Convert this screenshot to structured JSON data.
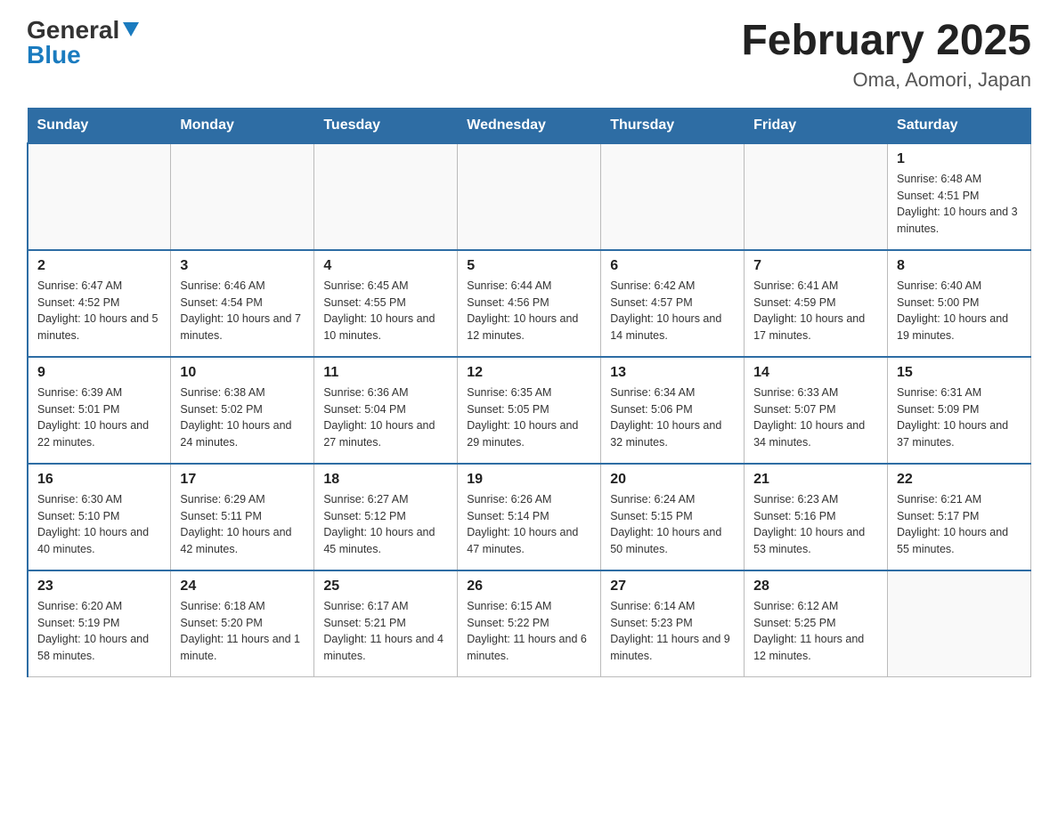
{
  "header": {
    "logo_general": "General",
    "logo_blue": "Blue",
    "month_title": "February 2025",
    "location": "Oma, Aomori, Japan"
  },
  "days_of_week": [
    "Sunday",
    "Monday",
    "Tuesday",
    "Wednesday",
    "Thursday",
    "Friday",
    "Saturday"
  ],
  "weeks": [
    [
      {
        "day": "",
        "sunrise": "",
        "sunset": "",
        "daylight": "",
        "empty": true
      },
      {
        "day": "",
        "sunrise": "",
        "sunset": "",
        "daylight": "",
        "empty": true
      },
      {
        "day": "",
        "sunrise": "",
        "sunset": "",
        "daylight": "",
        "empty": true
      },
      {
        "day": "",
        "sunrise": "",
        "sunset": "",
        "daylight": "",
        "empty": true
      },
      {
        "day": "",
        "sunrise": "",
        "sunset": "",
        "daylight": "",
        "empty": true
      },
      {
        "day": "",
        "sunrise": "",
        "sunset": "",
        "daylight": "",
        "empty": true
      },
      {
        "day": "1",
        "sunrise": "Sunrise: 6:48 AM",
        "sunset": "Sunset: 4:51 PM",
        "daylight": "Daylight: 10 hours and 3 minutes.",
        "empty": false
      }
    ],
    [
      {
        "day": "2",
        "sunrise": "Sunrise: 6:47 AM",
        "sunset": "Sunset: 4:52 PM",
        "daylight": "Daylight: 10 hours and 5 minutes.",
        "empty": false
      },
      {
        "day": "3",
        "sunrise": "Sunrise: 6:46 AM",
        "sunset": "Sunset: 4:54 PM",
        "daylight": "Daylight: 10 hours and 7 minutes.",
        "empty": false
      },
      {
        "day": "4",
        "sunrise": "Sunrise: 6:45 AM",
        "sunset": "Sunset: 4:55 PM",
        "daylight": "Daylight: 10 hours and 10 minutes.",
        "empty": false
      },
      {
        "day": "5",
        "sunrise": "Sunrise: 6:44 AM",
        "sunset": "Sunset: 4:56 PM",
        "daylight": "Daylight: 10 hours and 12 minutes.",
        "empty": false
      },
      {
        "day": "6",
        "sunrise": "Sunrise: 6:42 AM",
        "sunset": "Sunset: 4:57 PM",
        "daylight": "Daylight: 10 hours and 14 minutes.",
        "empty": false
      },
      {
        "day": "7",
        "sunrise": "Sunrise: 6:41 AM",
        "sunset": "Sunset: 4:59 PM",
        "daylight": "Daylight: 10 hours and 17 minutes.",
        "empty": false
      },
      {
        "day": "8",
        "sunrise": "Sunrise: 6:40 AM",
        "sunset": "Sunset: 5:00 PM",
        "daylight": "Daylight: 10 hours and 19 minutes.",
        "empty": false
      }
    ],
    [
      {
        "day": "9",
        "sunrise": "Sunrise: 6:39 AM",
        "sunset": "Sunset: 5:01 PM",
        "daylight": "Daylight: 10 hours and 22 minutes.",
        "empty": false
      },
      {
        "day": "10",
        "sunrise": "Sunrise: 6:38 AM",
        "sunset": "Sunset: 5:02 PM",
        "daylight": "Daylight: 10 hours and 24 minutes.",
        "empty": false
      },
      {
        "day": "11",
        "sunrise": "Sunrise: 6:36 AM",
        "sunset": "Sunset: 5:04 PM",
        "daylight": "Daylight: 10 hours and 27 minutes.",
        "empty": false
      },
      {
        "day": "12",
        "sunrise": "Sunrise: 6:35 AM",
        "sunset": "Sunset: 5:05 PM",
        "daylight": "Daylight: 10 hours and 29 minutes.",
        "empty": false
      },
      {
        "day": "13",
        "sunrise": "Sunrise: 6:34 AM",
        "sunset": "Sunset: 5:06 PM",
        "daylight": "Daylight: 10 hours and 32 minutes.",
        "empty": false
      },
      {
        "day": "14",
        "sunrise": "Sunrise: 6:33 AM",
        "sunset": "Sunset: 5:07 PM",
        "daylight": "Daylight: 10 hours and 34 minutes.",
        "empty": false
      },
      {
        "day": "15",
        "sunrise": "Sunrise: 6:31 AM",
        "sunset": "Sunset: 5:09 PM",
        "daylight": "Daylight: 10 hours and 37 minutes.",
        "empty": false
      }
    ],
    [
      {
        "day": "16",
        "sunrise": "Sunrise: 6:30 AM",
        "sunset": "Sunset: 5:10 PM",
        "daylight": "Daylight: 10 hours and 40 minutes.",
        "empty": false
      },
      {
        "day": "17",
        "sunrise": "Sunrise: 6:29 AM",
        "sunset": "Sunset: 5:11 PM",
        "daylight": "Daylight: 10 hours and 42 minutes.",
        "empty": false
      },
      {
        "day": "18",
        "sunrise": "Sunrise: 6:27 AM",
        "sunset": "Sunset: 5:12 PM",
        "daylight": "Daylight: 10 hours and 45 minutes.",
        "empty": false
      },
      {
        "day": "19",
        "sunrise": "Sunrise: 6:26 AM",
        "sunset": "Sunset: 5:14 PM",
        "daylight": "Daylight: 10 hours and 47 minutes.",
        "empty": false
      },
      {
        "day": "20",
        "sunrise": "Sunrise: 6:24 AM",
        "sunset": "Sunset: 5:15 PM",
        "daylight": "Daylight: 10 hours and 50 minutes.",
        "empty": false
      },
      {
        "day": "21",
        "sunrise": "Sunrise: 6:23 AM",
        "sunset": "Sunset: 5:16 PM",
        "daylight": "Daylight: 10 hours and 53 minutes.",
        "empty": false
      },
      {
        "day": "22",
        "sunrise": "Sunrise: 6:21 AM",
        "sunset": "Sunset: 5:17 PM",
        "daylight": "Daylight: 10 hours and 55 minutes.",
        "empty": false
      }
    ],
    [
      {
        "day": "23",
        "sunrise": "Sunrise: 6:20 AM",
        "sunset": "Sunset: 5:19 PM",
        "daylight": "Daylight: 10 hours and 58 minutes.",
        "empty": false
      },
      {
        "day": "24",
        "sunrise": "Sunrise: 6:18 AM",
        "sunset": "Sunset: 5:20 PM",
        "daylight": "Daylight: 11 hours and 1 minute.",
        "empty": false
      },
      {
        "day": "25",
        "sunrise": "Sunrise: 6:17 AM",
        "sunset": "Sunset: 5:21 PM",
        "daylight": "Daylight: 11 hours and 4 minutes.",
        "empty": false
      },
      {
        "day": "26",
        "sunrise": "Sunrise: 6:15 AM",
        "sunset": "Sunset: 5:22 PM",
        "daylight": "Daylight: 11 hours and 6 minutes.",
        "empty": false
      },
      {
        "day": "27",
        "sunrise": "Sunrise: 6:14 AM",
        "sunset": "Sunset: 5:23 PM",
        "daylight": "Daylight: 11 hours and 9 minutes.",
        "empty": false
      },
      {
        "day": "28",
        "sunrise": "Sunrise: 6:12 AM",
        "sunset": "Sunset: 5:25 PM",
        "daylight": "Daylight: 11 hours and 12 minutes.",
        "empty": false
      },
      {
        "day": "",
        "sunrise": "",
        "sunset": "",
        "daylight": "",
        "empty": true
      }
    ]
  ]
}
